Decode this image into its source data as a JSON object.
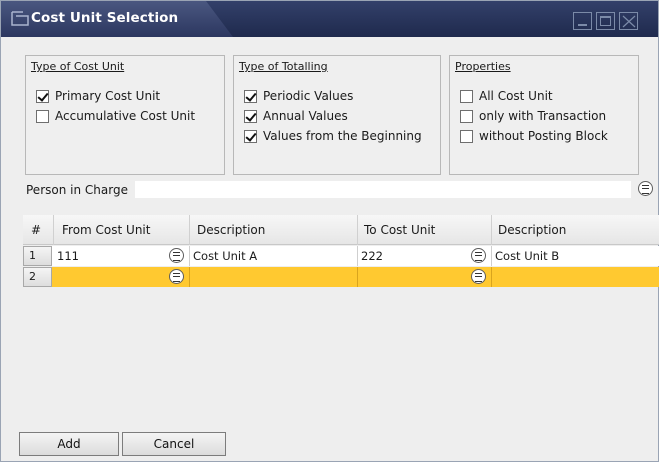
{
  "window": {
    "title": "Cost Unit Selection"
  },
  "type_of_cost_unit": {
    "title": "Type of Cost Unit",
    "options": [
      {
        "label": "Primary Cost Unit",
        "checked": true
      },
      {
        "label": "Accumulative Cost Unit",
        "checked": false
      }
    ]
  },
  "type_of_totalling": {
    "title": "Type of Totalling",
    "options": [
      {
        "label": "Periodic Values",
        "checked": true
      },
      {
        "label": "Annual Values",
        "checked": true
      },
      {
        "label": "Values from the Beginning",
        "checked": true
      }
    ]
  },
  "properties": {
    "title": "Properties",
    "options": [
      {
        "label": "All Cost Unit",
        "checked": false
      },
      {
        "label": "only with Transaction",
        "checked": false
      },
      {
        "label": "without Posting Block",
        "checked": false
      }
    ]
  },
  "person_in_charge": {
    "label": "Person in Charge",
    "value": ""
  },
  "grid": {
    "headers": [
      "#",
      "From Cost Unit",
      "Description",
      "To Cost Unit",
      "Description"
    ],
    "rows": [
      {
        "num": "1",
        "from": "111",
        "from_desc": "Cost Unit A",
        "to": "222",
        "to_desc": "Cost Unit B"
      },
      {
        "num": "2",
        "from": "",
        "from_desc": "",
        "to": "",
        "to_desc": ""
      }
    ]
  },
  "buttons": {
    "add": "Add",
    "cancel": "Cancel"
  },
  "colors": {
    "title_bar": "#1f2a4d",
    "selected_row": "#ffc930"
  }
}
